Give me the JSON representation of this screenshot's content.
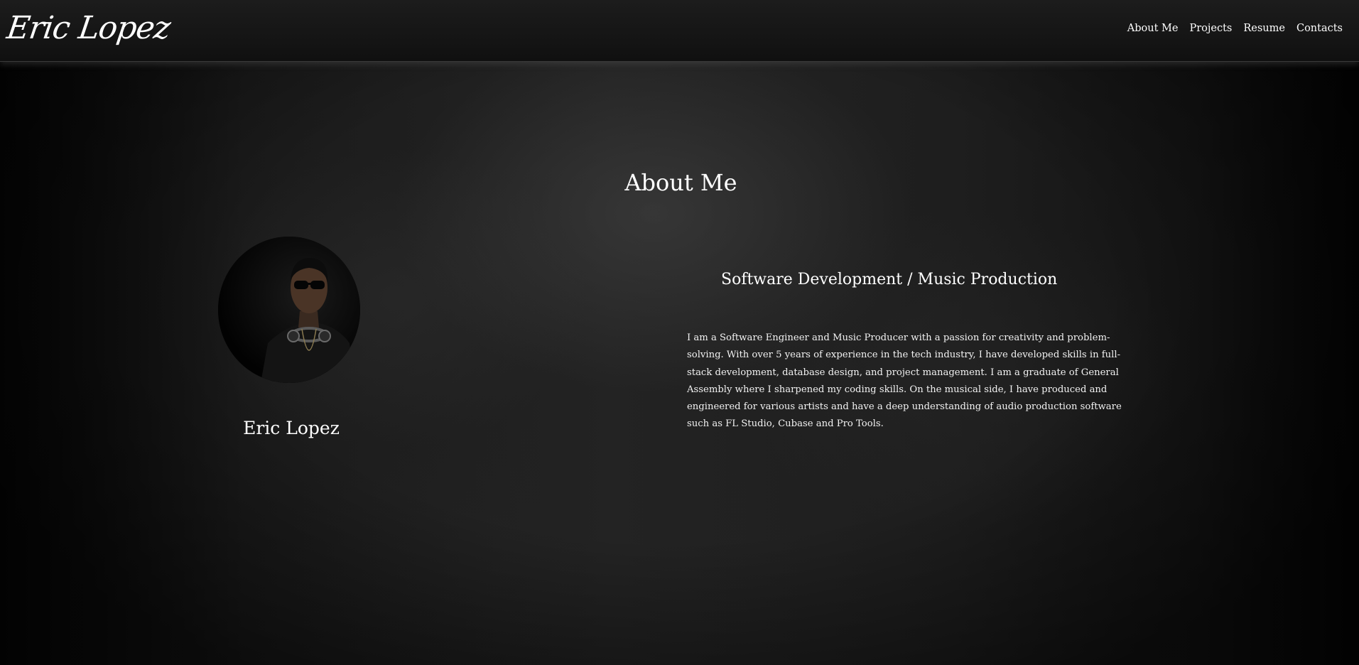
{
  "header": {
    "brand": "Eric Lopez",
    "nav": [
      {
        "label": "About Me"
      },
      {
        "label": "Projects"
      },
      {
        "label": "Resume"
      },
      {
        "label": "Contacts"
      }
    ]
  },
  "main": {
    "title": "About Me",
    "profile": {
      "name": "Eric Lopez"
    },
    "subtitle": "Software Development / Music Production",
    "bio": "I am a Software Engineer and Music Producer with a passion for creativity and problem-solving. With over 5 years of experience in the tech industry, I have developed skills in full-stack development, database design, and project management. I am a graduate of General Assembly where I sharpened my coding skills. On the musical side, I have produced and engineered for various artists and have a deep understanding of audio production software such as FL Studio, Cubase and Pro Tools."
  },
  "colors": {
    "background": "#1e1e1e",
    "text": "#ffffff",
    "navbar": "#151515"
  }
}
